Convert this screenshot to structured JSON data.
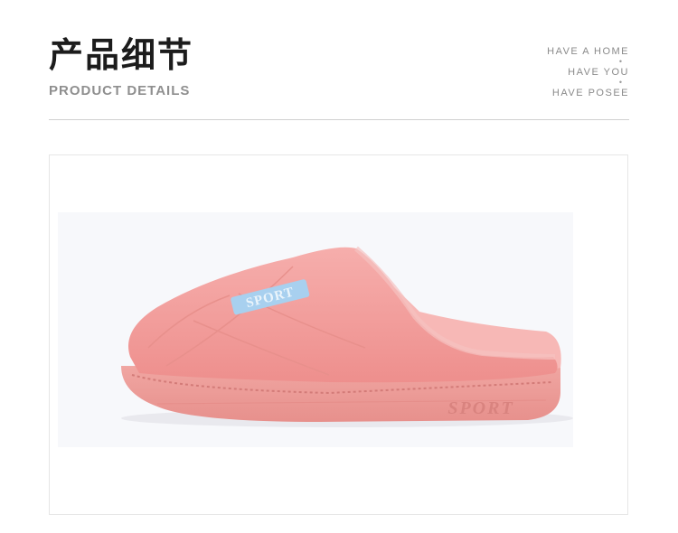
{
  "header": {
    "title_cn": "产品细节",
    "title_en": "PRODUCT DETAILS",
    "slogans": [
      "HAVE A HOME",
      "HAVE YOU",
      "HAVE POSEE"
    ]
  },
  "product": {
    "upper_label": "SPORT",
    "sole_label": "SPORT",
    "color": "#f4a2a0",
    "label_color": "#9ec9ea"
  }
}
